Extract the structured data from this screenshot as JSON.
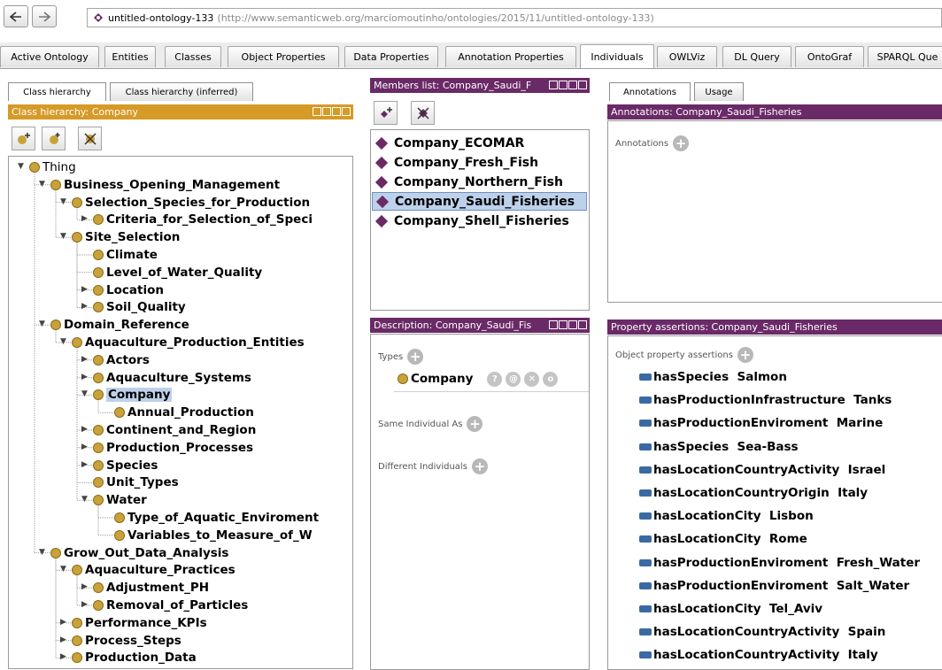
{
  "nav": {
    "back_icon": "back-arrow-icon",
    "forward_icon": "forward-arrow-icon"
  },
  "address": {
    "name": "untitled-ontology-133",
    "uri": "(http://www.semanticweb.org/marciomoutinho/ontologies/2015/11/untitled-ontology-133)"
  },
  "tabs": [
    "Active Ontology",
    "Entities",
    "Classes",
    "Object Properties",
    "Data Properties",
    "Annotation Properties",
    "Individuals",
    "OWLViz",
    "DL Query",
    "OntoGraf",
    "SPARQL Que"
  ],
  "active_tab": "Individuals",
  "left": {
    "subtabs": [
      "Class hierarchy",
      "Class hierarchy (inferred)"
    ],
    "header": "Class hierarchy: Company",
    "tree": [
      {
        "label": "Thing",
        "plain": true
      },
      {
        "label": "Business_Opening_Management"
      },
      {
        "label": "Selection_Species_for_Production"
      },
      {
        "label": "Criteria_for_Selection_of_Speci"
      },
      {
        "label": "Site_Selection"
      },
      {
        "label": "Climate"
      },
      {
        "label": "Level_of_Water_Quality"
      },
      {
        "label": "Location"
      },
      {
        "label": "Soil_Quality"
      },
      {
        "label": "Domain_Reference"
      },
      {
        "label": "Aquaculture_Production_Entities"
      },
      {
        "label": "Actors"
      },
      {
        "label": "Aquaculture_Systems"
      },
      {
        "label": "Company",
        "selected": true
      },
      {
        "label": "Annual_Production"
      },
      {
        "label": "Continent_and_Region"
      },
      {
        "label": "Production_Processes"
      },
      {
        "label": "Species"
      },
      {
        "label": "Unit_Types"
      },
      {
        "label": "Water"
      },
      {
        "label": "Type_of_Aquatic_Enviroment"
      },
      {
        "label": "Variables_to_Measure_of_W"
      },
      {
        "label": "Grow_Out_Data_Analysis"
      },
      {
        "label": "Aquaculture_Practices"
      },
      {
        "label": "Adjustment_PH"
      },
      {
        "label": "Removal_of_Particles"
      },
      {
        "label": "Performance_KPIs"
      },
      {
        "label": "Process_Steps"
      },
      {
        "label": "Production_Data"
      }
    ]
  },
  "members": {
    "header": "Members list: Company_Saudi_F",
    "items": [
      "Company_ECOMAR",
      "Company_Fresh_Fish",
      "Company_Northern_Fish",
      "Company_Saudi_Fisheries",
      "Company_Shell_Fisheries"
    ],
    "selected": "Company_Saudi_Fisheries"
  },
  "description": {
    "header": "Description: Company_Saudi_Fis",
    "types_label": "Types",
    "type_value": "Company",
    "same_label": "Same Individual As",
    "different_label": "Different Individuals"
  },
  "annotations": {
    "subtabs": [
      "Annotations",
      "Usage"
    ],
    "header": "Annotations: Company_Saudi_Fisheries",
    "label": "Annotations"
  },
  "properties": {
    "header": "Property assertions: Company_Saudi_Fisheries",
    "label": "Object property assertions",
    "items": [
      "hasSpecies  Salmon",
      "hasProductionInfrastructure  Tanks",
      "hasProductionEnviroment  Marine",
      "hasSpecies  Sea-Bass",
      "hasLocationCountryActivity  Israel",
      "hasLocationCountryOrigin  Italy",
      "hasLocationCity  Lisbon",
      "hasLocationCity  Rome",
      "hasProductionEnviroment  Fresh_Water",
      "hasProductionEnviroment  Salt_Water",
      "hasLocationCity  Tel_Aviv",
      "hasLocationCountryActivity  Spain",
      "hasLocationCountryActivity  Italy"
    ]
  },
  "colors": {
    "header_purple": "#6a2a67",
    "header_orange": "#d69a26",
    "selection": "#bed1ea",
    "class_dot": "#c9a23a"
  }
}
